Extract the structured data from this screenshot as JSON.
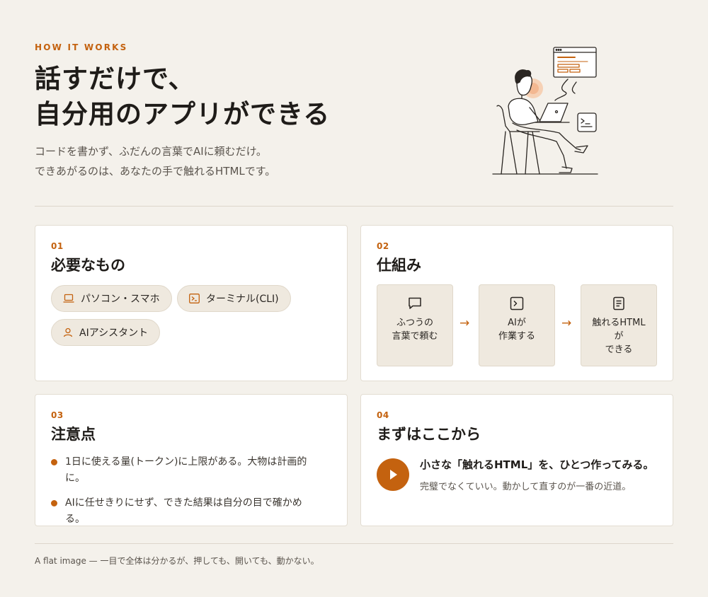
{
  "header": {
    "eyebrow": "HOW IT WORKS",
    "title_line1": "話すだけで、",
    "title_line2": "自分用のアプリができる",
    "subtitle_line1": "コードを書かず、ふだんの言葉でAIに頼むだけ。",
    "subtitle_line2": "できあがるのは、あなたの手で触れるHTMLです。"
  },
  "cards": {
    "requirements": {
      "number": "01",
      "title": "必要なもの",
      "items": [
        {
          "label": "パソコン・スマホ",
          "icon": "laptop-icon"
        },
        {
          "label": "ターミナル(CLI)",
          "icon": "terminal-icon"
        },
        {
          "label": "AIアシスタント",
          "icon": "person-icon"
        }
      ]
    },
    "mechanism": {
      "number": "02",
      "title": "仕組み",
      "steps": [
        {
          "label": "ふつうの\n言葉で頼む",
          "icon": "chat-bubble-icon"
        },
        {
          "label": "AIが\n作業する",
          "icon": "terminal-icon"
        },
        {
          "label": "触れるHTML\nが\nできる",
          "icon": "document-icon"
        }
      ],
      "arrow": "→"
    },
    "cautions": {
      "number": "03",
      "title": "注意点",
      "items": [
        "1日に使える量(トークン)に上限がある。大物は計画的に。",
        "AIに任せきりにせず、できた結果は自分の目で確かめる。"
      ]
    },
    "start": {
      "number": "04",
      "title": "まずはここから",
      "headline": "小さな「触れるHTML」を、ひとつ作ってみる。",
      "body": "完璧でなくていい。動かして直すのが一番の近道。"
    }
  },
  "footer": "A flat image — 一目で全体は分かるが、押しても、開いても、動かない。",
  "colors": {
    "background": "#f4f1eb",
    "accent": "#c4620f",
    "card": "#ffffff",
    "chip": "#efe9df"
  }
}
